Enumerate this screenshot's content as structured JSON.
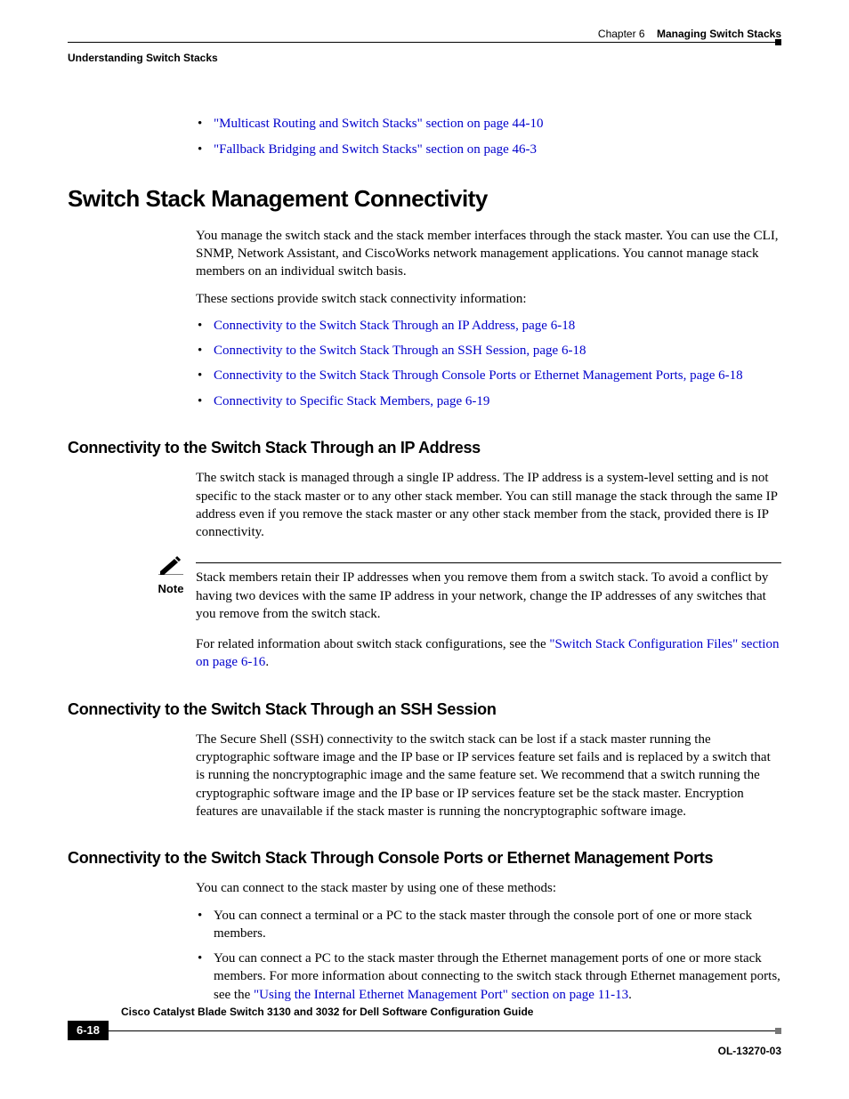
{
  "header": {
    "chapter_label": "Chapter 6",
    "chapter_title": "Managing Switch Stacks",
    "section_running": "Understanding Switch Stacks"
  },
  "top_links": [
    "\"Multicast Routing and Switch Stacks\" section on page 44-10",
    "\"Fallback Bridging and Switch Stacks\" section on page 46-3"
  ],
  "h1": "Switch Stack Management Connectivity",
  "intro_p1": "You manage the switch stack and the stack member interfaces through the stack master. You can use the CLI, SNMP, Network Assistant, and CiscoWorks network management applications. You cannot manage stack members on an individual switch basis.",
  "intro_p2": "These sections provide switch stack connectivity information:",
  "intro_links": [
    "Connectivity to the Switch Stack Through an IP Address, page 6-18",
    "Connectivity to the Switch Stack Through an SSH Session, page 6-18",
    "Connectivity to the Switch Stack Through Console Ports or Ethernet Management Ports, page 6-18",
    "Connectivity to Specific Stack Members, page 6-19"
  ],
  "sub1": {
    "title": "Connectivity to the Switch Stack Through an IP Address",
    "p1": "The switch stack is managed through a single IP address. The IP address is a system-level setting and is not specific to the stack master or to any other stack member. You can still manage the stack through the same IP address even if you remove the stack master or any other stack member from the stack, provided there is IP connectivity.",
    "note_label": "Note",
    "note_body": "Stack members retain their IP addresses when you remove them from a switch stack. To avoid a conflict by having two devices with the same IP address in your network, change the IP addresses of any switches that you remove from the switch stack.",
    "p2_pre": "For related information about switch stack configurations, see the ",
    "p2_link": "\"Switch Stack Configuration Files\" section on page 6-16",
    "p2_post": "."
  },
  "sub2": {
    "title": "Connectivity to the Switch Stack Through an SSH Session",
    "p1": "The Secure Shell (SSH) connectivity to the switch stack can be lost if a stack master running the cryptographic software image and the IP base or IP services feature set fails and is replaced by a switch that is running the noncryptographic image and the same feature set. We recommend that a switch running the cryptographic software image and the IP base or IP services feature set be the stack master. Encryption features are unavailable if the stack master is running the noncryptographic software image."
  },
  "sub3": {
    "title": "Connectivity to the Switch Stack Through Console Ports or Ethernet Management Ports",
    "p1": "You can connect to the stack master by using one of these methods:",
    "b1": "You can connect a terminal or a PC to the stack master through the console port of one or more stack members.",
    "b2_pre": "You can connect a PC to the stack master through the Ethernet management ports of one or more stack members. For more information about connecting to the switch stack through Ethernet management ports, see the ",
    "b2_link": "\"Using the Internal Ethernet Management Port\" section on page 11-13",
    "b2_post": "."
  },
  "footer": {
    "book_title": "Cisco Catalyst Blade Switch 3130 and 3032 for Dell Software Configuration Guide",
    "page_number": "6-18",
    "doc_code": "OL-13270-03"
  }
}
